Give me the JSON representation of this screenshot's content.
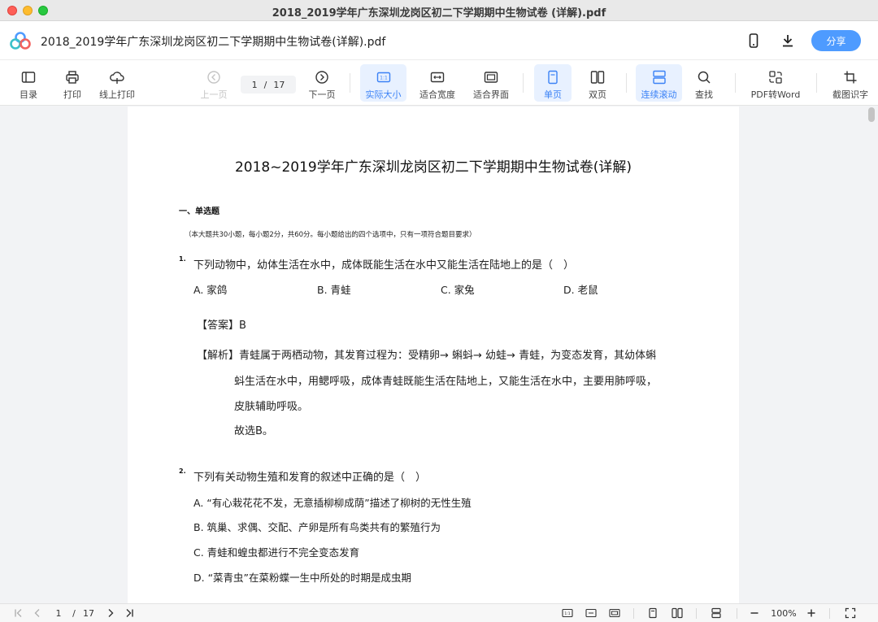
{
  "window": {
    "title": "2018_2019学年广东深圳龙岗区初二下学期期中生物试卷 (详解).pdf"
  },
  "header": {
    "file_name": "2018_2019学年广东深圳龙岗区初二下学期期中生物试卷(详解).pdf",
    "share_label": "分享",
    "icons": [
      "mobile-icon",
      "download-icon"
    ]
  },
  "toolbar": {
    "catalog": "目录",
    "print": "打印",
    "online_print": "线上打印",
    "prev_page": "上一页",
    "current_page": "1",
    "page_sep": "/",
    "total_pages": "17",
    "next_page": "下一页",
    "actual_size": "实际大小",
    "fit_width": "适合宽度",
    "fit_page": "适合界面",
    "single_page": "单页",
    "double_page": "双页",
    "continuous_scroll": "连续滚动",
    "find": "查找",
    "pdf_to_word": "PDF转Word",
    "ocr": "截图识字",
    "active_color": "#3b82f6"
  },
  "document": {
    "title": "2018~2019学年广东深圳龙岗区初二下学期期中生物试卷(详解)",
    "section_title": "一、单选题",
    "section_note": "（本大题共30小题，每小题2分，共60分。每小题给出的四个选项中，只有一项符合题目要求）",
    "q1": {
      "num": "1.",
      "text": "下列动物中，幼体生活在水中，成体既能生活在水中又能生活在陆地上的是（　）",
      "options": [
        "A. 家鸽",
        "B. 青蛙",
        "C. 家兔",
        "D. 老鼠"
      ],
      "answer": "【答案】B",
      "analysis_1": "【解析】青蛙属于两栖动物，其发育过程为：受精卵→ 蝌蚪→ 幼蛙→ 青蛙，为变态发育，其幼体蝌",
      "analysis_2": "蚪生活在水中，用鳃呼吸，成体青蛙既能生活在陆地上，又能生活在水中，主要用肺呼吸，",
      "analysis_3": "皮肤辅助呼吸。",
      "analysis_4": "故选B。"
    },
    "q2": {
      "num": "2.",
      "text": "下列有关动物生殖和发育的叙述中正确的是（　）",
      "options": [
        "A. “有心栽花花不发，无意插柳柳成荫”描述了柳树的无性生殖",
        "B. 筑巢、求偶、交配、产卵是所有鸟类共有的繁殖行为",
        "C. 青蛙和蝗虫都进行不完全变态发育",
        "D. “菜青虫”在菜粉蝶一生中所处的时期是成虫期"
      ]
    }
  },
  "bottombar": {
    "current_page": "1",
    "page_sep": "/",
    "total_pages": "17",
    "zoom": "100%"
  }
}
